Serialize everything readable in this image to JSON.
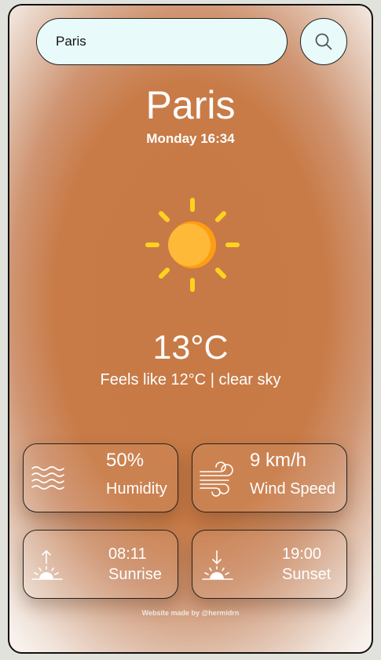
{
  "search": {
    "value": "Paris",
    "icon": "search-icon"
  },
  "city": "Paris",
  "datetime": "Monday 16:34",
  "weather_icon": "sun-icon",
  "temperature": "13°C",
  "description": "Feels like 12°C | clear sky",
  "cards": {
    "humidity": {
      "value": "50%",
      "label": "Humidity",
      "icon": "water-waves-icon"
    },
    "wind": {
      "value": "9 km/h",
      "label": "Wind Speed",
      "icon": "wind-icon"
    },
    "sunrise": {
      "value": "08:11",
      "label": "Sunrise",
      "icon": "sunrise-icon"
    },
    "sunset": {
      "value": "19:00",
      "label": "Sunset",
      "icon": "sunset-icon"
    }
  },
  "footer": "Website made by @hermidrn",
  "colors": {
    "background": "#c77a45",
    "input_background": "#e8fbfa",
    "sun": "#ffb938",
    "rays": "#ffd21f"
  }
}
